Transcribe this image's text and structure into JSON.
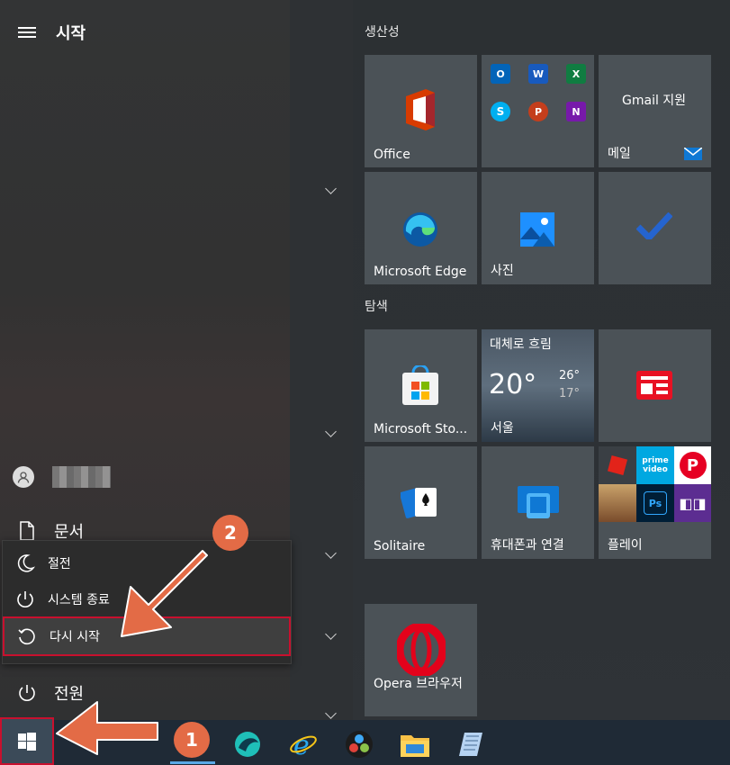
{
  "start": {
    "title": "시작"
  },
  "left_menu": {
    "user_name": "",
    "documents": "문서",
    "power": "전원"
  },
  "power_menu": {
    "sleep": "절전",
    "shutdown": "시스템 종료",
    "restart": "다시 시작"
  },
  "groups": {
    "productivity": "생산성",
    "explore": "탐색"
  },
  "tiles": {
    "office": "Office",
    "gmail_support": "Gmail 지원",
    "mail": "메일",
    "edge": "Microsoft Edge",
    "photos": "사진",
    "store": "Microsoft Sto...",
    "weather_condition": "대체로 흐림",
    "weather_temp": "20°",
    "weather_high": "26°",
    "weather_low": "17°",
    "weather_city": "서울",
    "solitaire": "Solitaire",
    "phone_link": "휴대폰과 연결",
    "play": "플레이",
    "opera": "Opera 브라우저"
  },
  "annotations": {
    "badge1": "1",
    "badge2": "2"
  },
  "colors": {
    "accent_orange": "#e36b46",
    "highlight_red": "#c8102e",
    "taskbar": "#1f2a36"
  }
}
